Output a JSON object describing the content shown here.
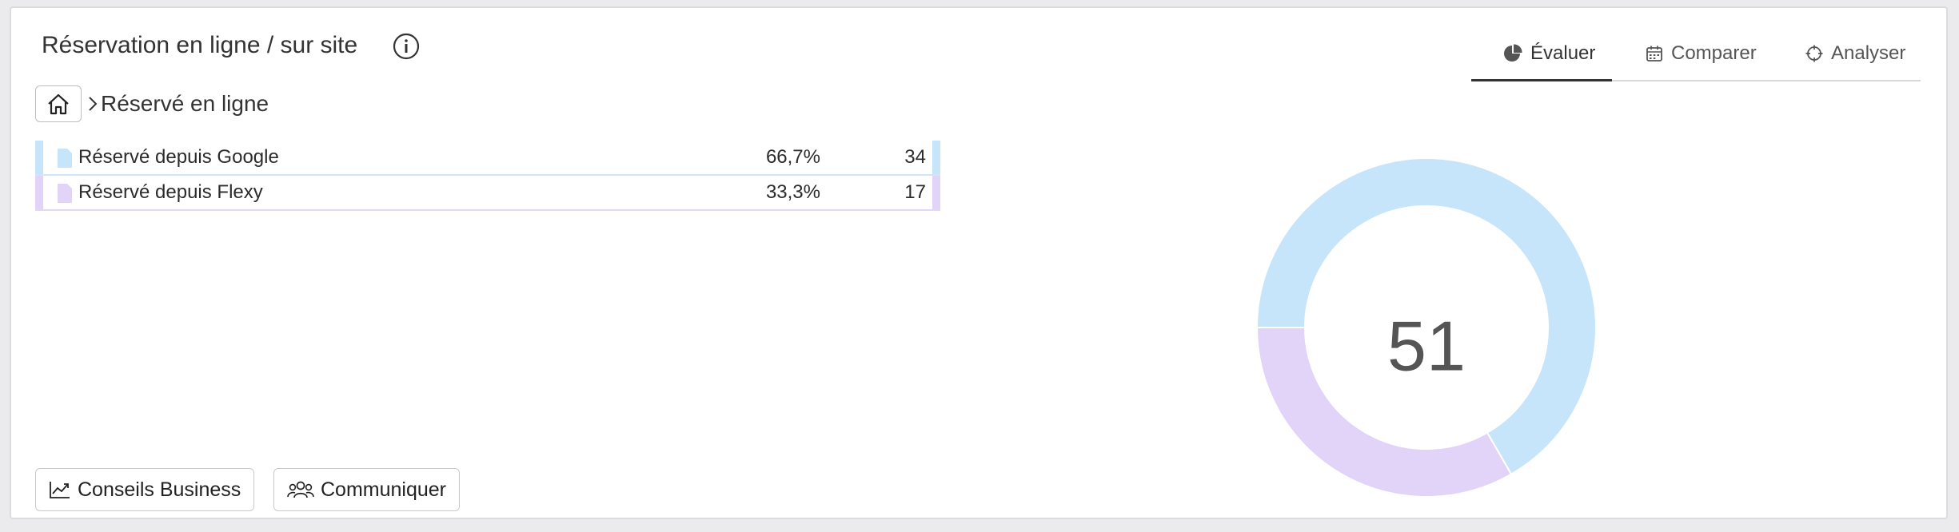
{
  "widget": {
    "title": "Réservation en ligne / sur site"
  },
  "tabs": [
    {
      "label": "Évaluer",
      "icon": "pie-chart-icon",
      "active": true
    },
    {
      "label": "Comparer",
      "icon": "calendar-icon",
      "active": false
    },
    {
      "label": "Analyser",
      "icon": "crosshair-icon",
      "active": false
    }
  ],
  "breadcrumb": {
    "current": "Réservé en ligne"
  },
  "rows": [
    {
      "label": "Réservé depuis Google",
      "percent": "66,7%",
      "count": "34",
      "color": "#c6e5fa"
    },
    {
      "label": "Réservé depuis Flexy",
      "percent": "33,3%",
      "count": "17",
      "color": "#e2d3f8"
    }
  ],
  "actions": {
    "business": "Conseils Business",
    "communicate": "Communiquer"
  },
  "chart_data": {
    "type": "pie",
    "center_label": "51",
    "categories": [
      "Réservé depuis Google",
      "Réservé depuis Flexy"
    ],
    "values": [
      34,
      17
    ],
    "colors": [
      "#c6e5fa",
      "#e2d3f8"
    ]
  }
}
